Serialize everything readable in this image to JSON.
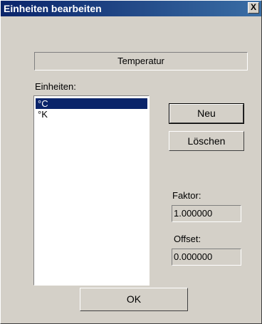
{
  "window": {
    "title": "Einheiten bearbeiten",
    "close_label": "X"
  },
  "category": {
    "value": "Temperatur"
  },
  "units": {
    "label": "Einheiten:",
    "items": [
      {
        "label": "°C",
        "selected": true
      },
      {
        "label": "°K",
        "selected": false
      }
    ]
  },
  "buttons": {
    "new_label": "Neu",
    "delete_label": "Löschen",
    "ok_label": "OK"
  },
  "factor": {
    "label": "Faktor:",
    "value": "1.000000"
  },
  "offset": {
    "label": "Offset:",
    "value": "0.000000"
  },
  "colors": {
    "title_bar": "#0a246a",
    "selection": "#0a246a",
    "dialog_face": "#d4d0c8"
  }
}
